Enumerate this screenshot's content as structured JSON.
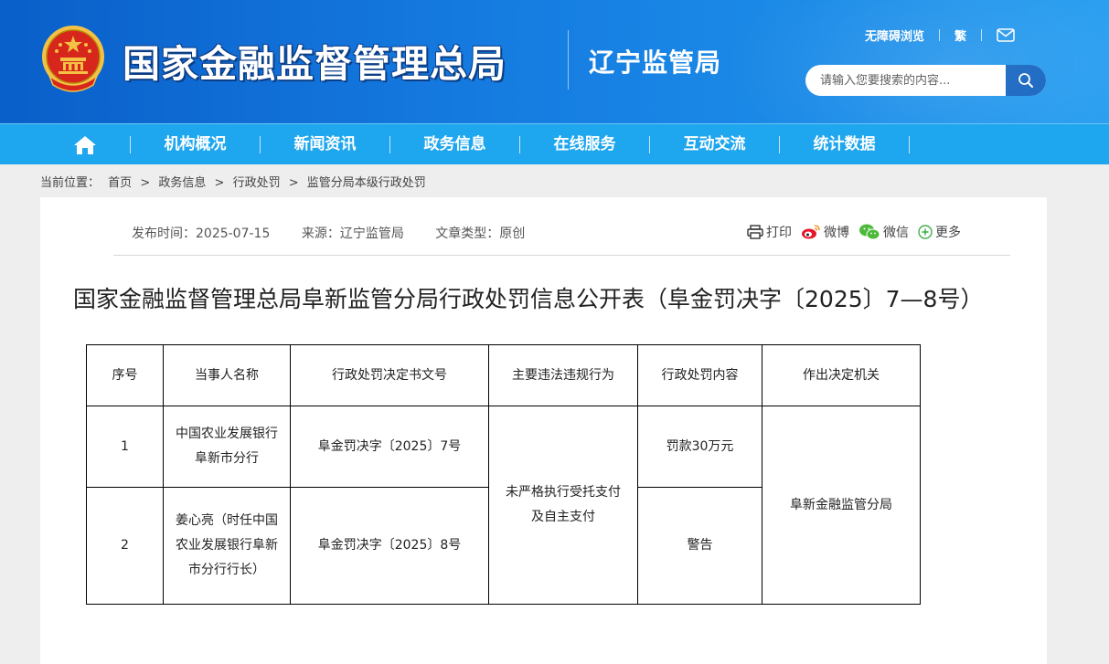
{
  "header": {
    "site_title": "国家金融监督管理总局",
    "sub_title": "辽宁监管局",
    "links": {
      "accessibility": "无障碍浏览",
      "traditional": "繁"
    },
    "search_placeholder": "请输入您要搜索的内容..."
  },
  "nav": {
    "items": [
      "机构概况",
      "新闻资讯",
      "政务信息",
      "在线服务",
      "互动交流",
      "统计数据"
    ]
  },
  "breadcrumb": {
    "label": "当前位置：",
    "items": [
      "首页",
      "政务信息",
      "行政处罚",
      "监管分局本级行政处罚"
    ],
    "separator": ">"
  },
  "article": {
    "meta": {
      "publish_time": "发布时间：2025-07-15",
      "source": "来源：辽宁监管局",
      "type": "文章类型：原创"
    },
    "share": {
      "print": "打印",
      "weibo": "微博",
      "wechat": "微信",
      "more": "更多"
    },
    "title": "国家金融监督管理总局阜新监管分局行政处罚信息公开表（阜金罚决字〔2025〕7—8号）",
    "table": {
      "headers": [
        "序号",
        "当事人名称",
        "行政处罚决定书文号",
        "主要违法违规行为",
        "行政处罚内容",
        "作出决定机关"
      ],
      "rows": [
        {
          "no": "1",
          "party": "中国农业发展银行阜新市分行",
          "doc_no": "阜金罚决字〔2025〕7号",
          "penalty": "罚款30万元"
        },
        {
          "no": "2",
          "party": "姜心亮（时任中国农业发展银行阜新市分行行长）",
          "doc_no": "阜金罚决字〔2025〕8号",
          "penalty": "警告"
        }
      ],
      "violation": "未严格执行受托支付及自主支付",
      "authority": "阜新金融监管分局"
    }
  },
  "colors": {
    "header_blue": "#1479df",
    "nav_blue": "#1ea6ee",
    "search_button": "#1565c0",
    "emblem_red": "#d7261b",
    "emblem_gold": "#f3c244"
  }
}
